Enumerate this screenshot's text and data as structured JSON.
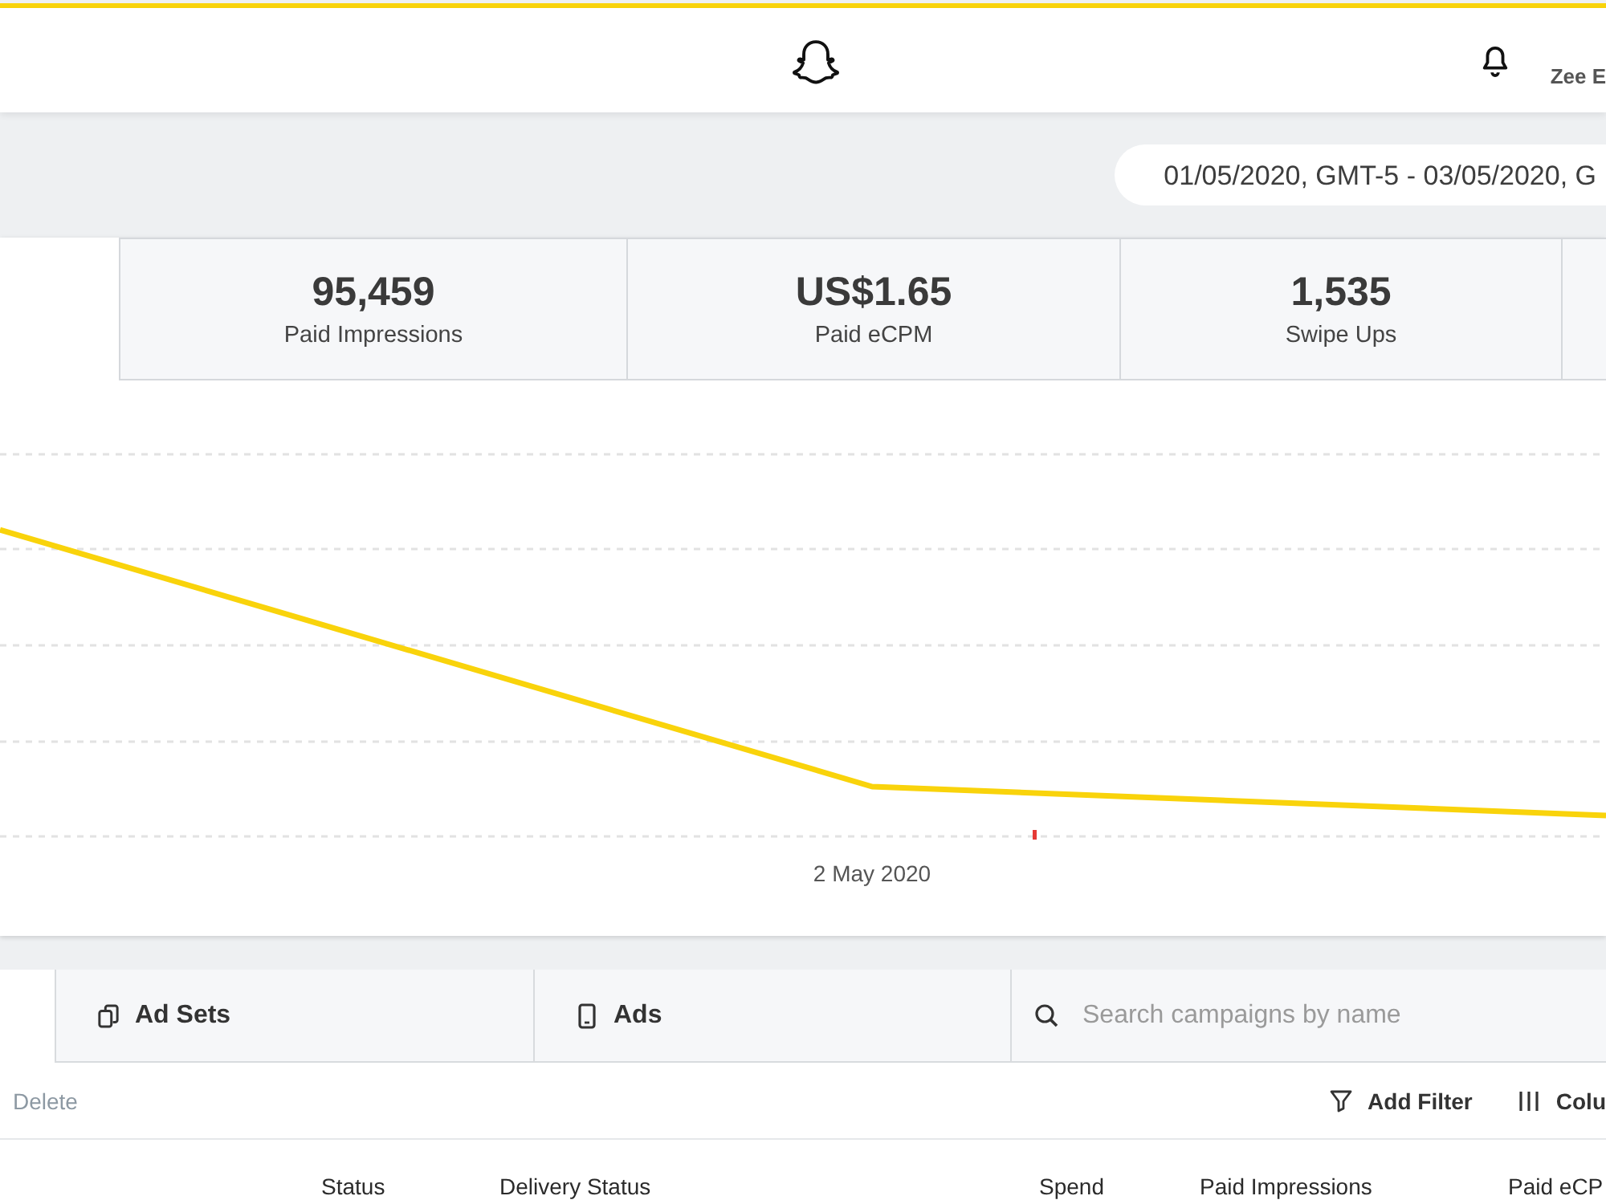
{
  "header": {
    "user_name": "Zee E"
  },
  "date_range": {
    "value": "01/05/2020, GMT-5 - 03/05/2020, G"
  },
  "stats": [
    {
      "value": "95,459",
      "label": "Paid Impressions"
    },
    {
      "value": "US$1.65",
      "label": "Paid eCPM"
    },
    {
      "value": "1,535",
      "label": "Swipe Ups"
    }
  ],
  "chart": {
    "x_label": "2 May 2020"
  },
  "tabs": [
    {
      "label": "Ad Sets",
      "selected": false
    },
    {
      "label": "Ads",
      "selected": false
    }
  ],
  "search": {
    "placeholder": "Search campaigns by name"
  },
  "toolbar": {
    "delete": {
      "label": "Delete",
      "disabled": true
    },
    "actions": [
      {
        "label": "Add Filter"
      },
      {
        "label": "Colu"
      }
    ]
  },
  "table": {
    "columns": [
      "Status",
      "Delivery Status",
      "Spend",
      "Paid Impressions",
      "Paid eCP"
    ]
  }
}
